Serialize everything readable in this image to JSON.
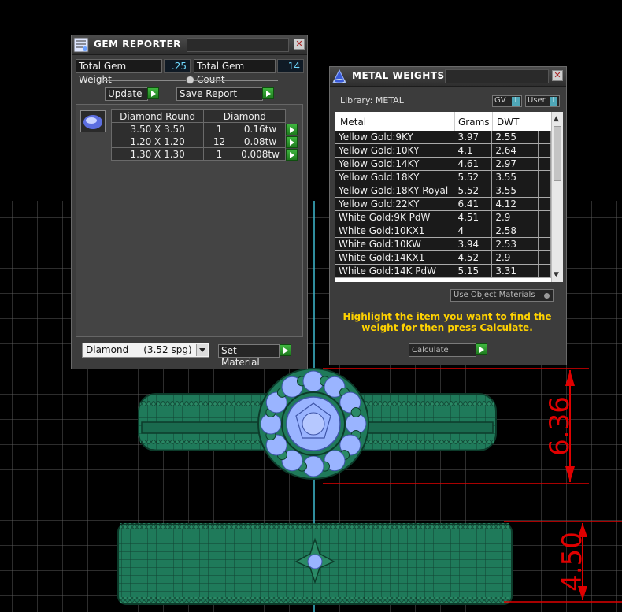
{
  "gem_reporter": {
    "title": "GEM REPORTER",
    "close_glyph": "✕",
    "total_weight_label": "Total Gem Weight",
    "total_weight_value": ".25",
    "total_count_label": "Total Gem Count",
    "total_count_value": "14",
    "update_label": "Update",
    "save_report_label": "Save Report",
    "table_headers": [
      "Diamond Round",
      "Diamond"
    ],
    "rows": [
      {
        "size": "3.50 X 3.50",
        "count": "1",
        "weight": "0.16tw"
      },
      {
        "size": "1.20 X 1.20",
        "count": "12",
        "weight": "0.08tw"
      },
      {
        "size": "1.30 X 1.30",
        "count": "1",
        "weight": "0.008tw"
      }
    ],
    "material_select": "Diamond     (3.52 spg)",
    "set_material_label": "Set Material"
  },
  "metal_weights": {
    "title": "METAL WEIGHTS",
    "close_glyph": "✕",
    "library_label": "Library: METAL",
    "gv_label": "GV",
    "user_label": "User",
    "columns": [
      "Metal",
      "Grams",
      "DWT"
    ],
    "rows": [
      {
        "metal": "Yellow Gold:9KY",
        "grams": "3.97",
        "dwt": "2.55"
      },
      {
        "metal": "Yellow Gold:10KY",
        "grams": "4.1",
        "dwt": "2.64"
      },
      {
        "metal": "Yellow Gold:14KY",
        "grams": "4.61",
        "dwt": "2.97"
      },
      {
        "metal": "Yellow Gold:18KY",
        "grams": "5.52",
        "dwt": "3.55"
      },
      {
        "metal": "Yellow Gold:18KY Royal",
        "grams": "5.52",
        "dwt": "3.55"
      },
      {
        "metal": "Yellow Gold:22KY",
        "grams": "6.41",
        "dwt": "4.12"
      },
      {
        "metal": "White Gold:9K PdW",
        "grams": "4.51",
        "dwt": "2.9"
      },
      {
        "metal": "White Gold:10KX1",
        "grams": "4",
        "dwt": "2.58"
      },
      {
        "metal": "White Gold:10KW",
        "grams": "3.94",
        "dwt": "2.53"
      },
      {
        "metal": "White Gold:14KX1",
        "grams": "4.52",
        "dwt": "2.9"
      },
      {
        "metal": "White Gold:14K PdW",
        "grams": "5.15",
        "dwt": "3.31"
      }
    ],
    "use_object_materials_label": "Use Object Materials",
    "hint_text": "Highlight the item you want to find the weight for then press Calculate.",
    "calculate_label": "Calculate"
  },
  "viewport": {
    "dimension_top": "6.36",
    "dimension_bottom": "4.50"
  },
  "colors": {
    "metal": "#1f7a5a",
    "gem": "#9ab4ff",
    "dimension": "#e00000",
    "grid": "#555555",
    "accent_green": "#2e9e2e",
    "hint": "#ffd200"
  }
}
